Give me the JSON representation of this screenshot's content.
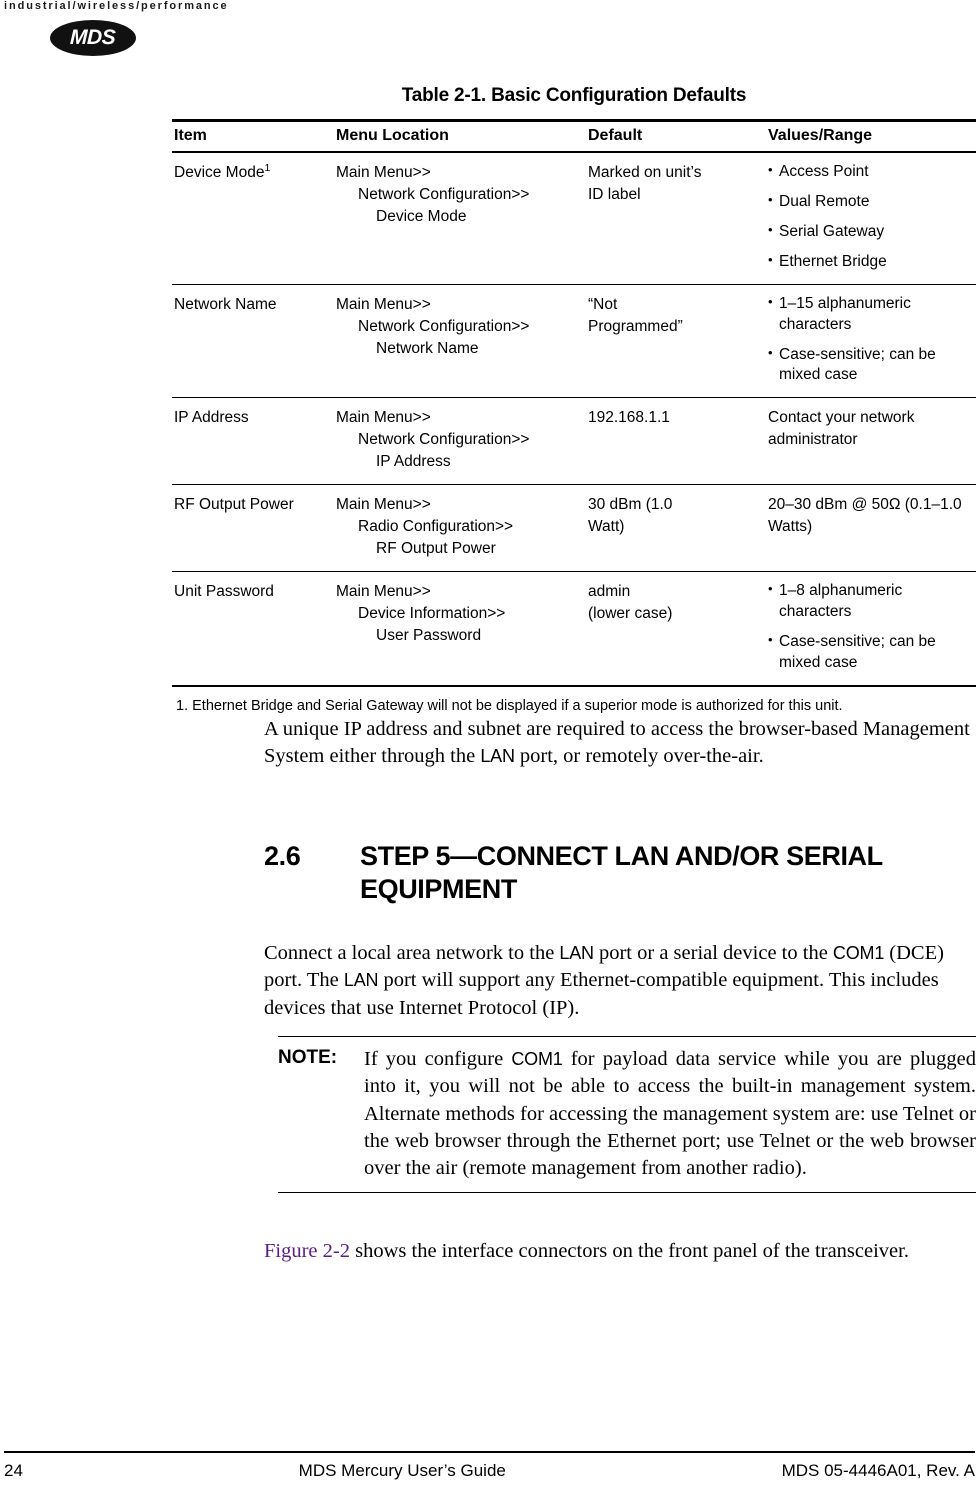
{
  "header": {
    "tagline": "industrial/wireless/performance",
    "logo_text": "MDS"
  },
  "table": {
    "caption": "Table 2-1. Basic Configuration Defaults",
    "columns": [
      "Item",
      "Menu Location",
      "Default",
      "Values/Range"
    ],
    "rows": [
      {
        "item": "Device Mode",
        "item_footnote": "1",
        "menu": [
          "Main Menu>>",
          "Network Configuration>>",
          "Device Mode"
        ],
        "default": [
          "Marked on unit’s",
          "ID label"
        ],
        "values": [
          "Access Point",
          "Dual Remote",
          "Serial Gateway",
          "Ethernet Bridge"
        ],
        "values_bulleted": true
      },
      {
        "item": "Network Name",
        "item_footnote": "",
        "menu": [
          "Main Menu>>",
          "Network Configuration>>",
          "Network Name"
        ],
        "default": [
          "“Not",
          "Programmed”"
        ],
        "values": [
          "1–15 alphanumeric characters",
          "Case-sensitive; can be mixed case"
        ],
        "values_bulleted": true
      },
      {
        "item": "IP Address",
        "item_footnote": "",
        "menu": [
          "Main Menu>>",
          "Network Configuration>>",
          "IP Address"
        ],
        "default": [
          "192.168.1.1"
        ],
        "values": [
          "Contact your network administrator"
        ],
        "values_bulleted": false
      },
      {
        "item": "RF Output Power",
        "item_footnote": "",
        "menu": [
          "Main Menu>>",
          "Radio Configuration>>",
          "RF Output Power"
        ],
        "default": [
          "30 dBm (1.0",
          "Watt)"
        ],
        "values": [
          "20–30 dBm @ 50Ω (0.1–1.0 Watts)"
        ],
        "values_bulleted": false
      },
      {
        "item": "Unit Password",
        "item_footnote": "",
        "menu": [
          "Main Menu>>",
          "Device Information>>",
          "User Password"
        ],
        "default": [
          "admin",
          "(lower case)"
        ],
        "values": [
          "1–8 alphanumeric characters",
          "Case-sensitive; can be mixed case"
        ],
        "values_bulleted": true
      }
    ],
    "footnote": "1.  Ethernet Bridge and Serial Gateway will not be displayed if a superior mode is authorized for this unit."
  },
  "intro_paragraph": {
    "part1": "A unique IP address and subnet are required to access the browser-based Management System either through the ",
    "term1": "LAN",
    "part2": " port, or remotely over-the-air."
  },
  "section": {
    "number": "2.6",
    "title": "STEP 5—CONNECT LAN AND/OR SERIAL EQUIPMENT"
  },
  "connect_paragraph": {
    "part1": "Connect a local area network to the ",
    "term1": "LAN",
    "part2": " port or a serial device to the ",
    "term2": "COM1",
    "part3": " (DCE) port. The ",
    "term3": "LAN",
    "part4": " port will support any Ethernet-compatible equipment. This includes devices that use Internet Protocol (IP)."
  },
  "note": {
    "label": "NOTE:",
    "part1": "If you configure ",
    "term1": "COM1",
    "part2": " for payload data service while you are plugged into it, you will not be able to access the built-in management system. Alternate methods for accessing the management system are: use Telnet or the web browser through the Ethernet port; use Telnet or the web browser over the air (remote management from another radio)."
  },
  "figure_paragraph": {
    "xref": "Figure 2-2",
    "text": " shows the interface connectors on the front panel of the transceiver."
  },
  "footer": {
    "page_number": "24",
    "title": "MDS Mercury User’s Guide",
    "doc_id": "MDS 05-4446A01, Rev. A"
  },
  "colors": {
    "xref": "#5b1d86",
    "rule": "#000000"
  }
}
